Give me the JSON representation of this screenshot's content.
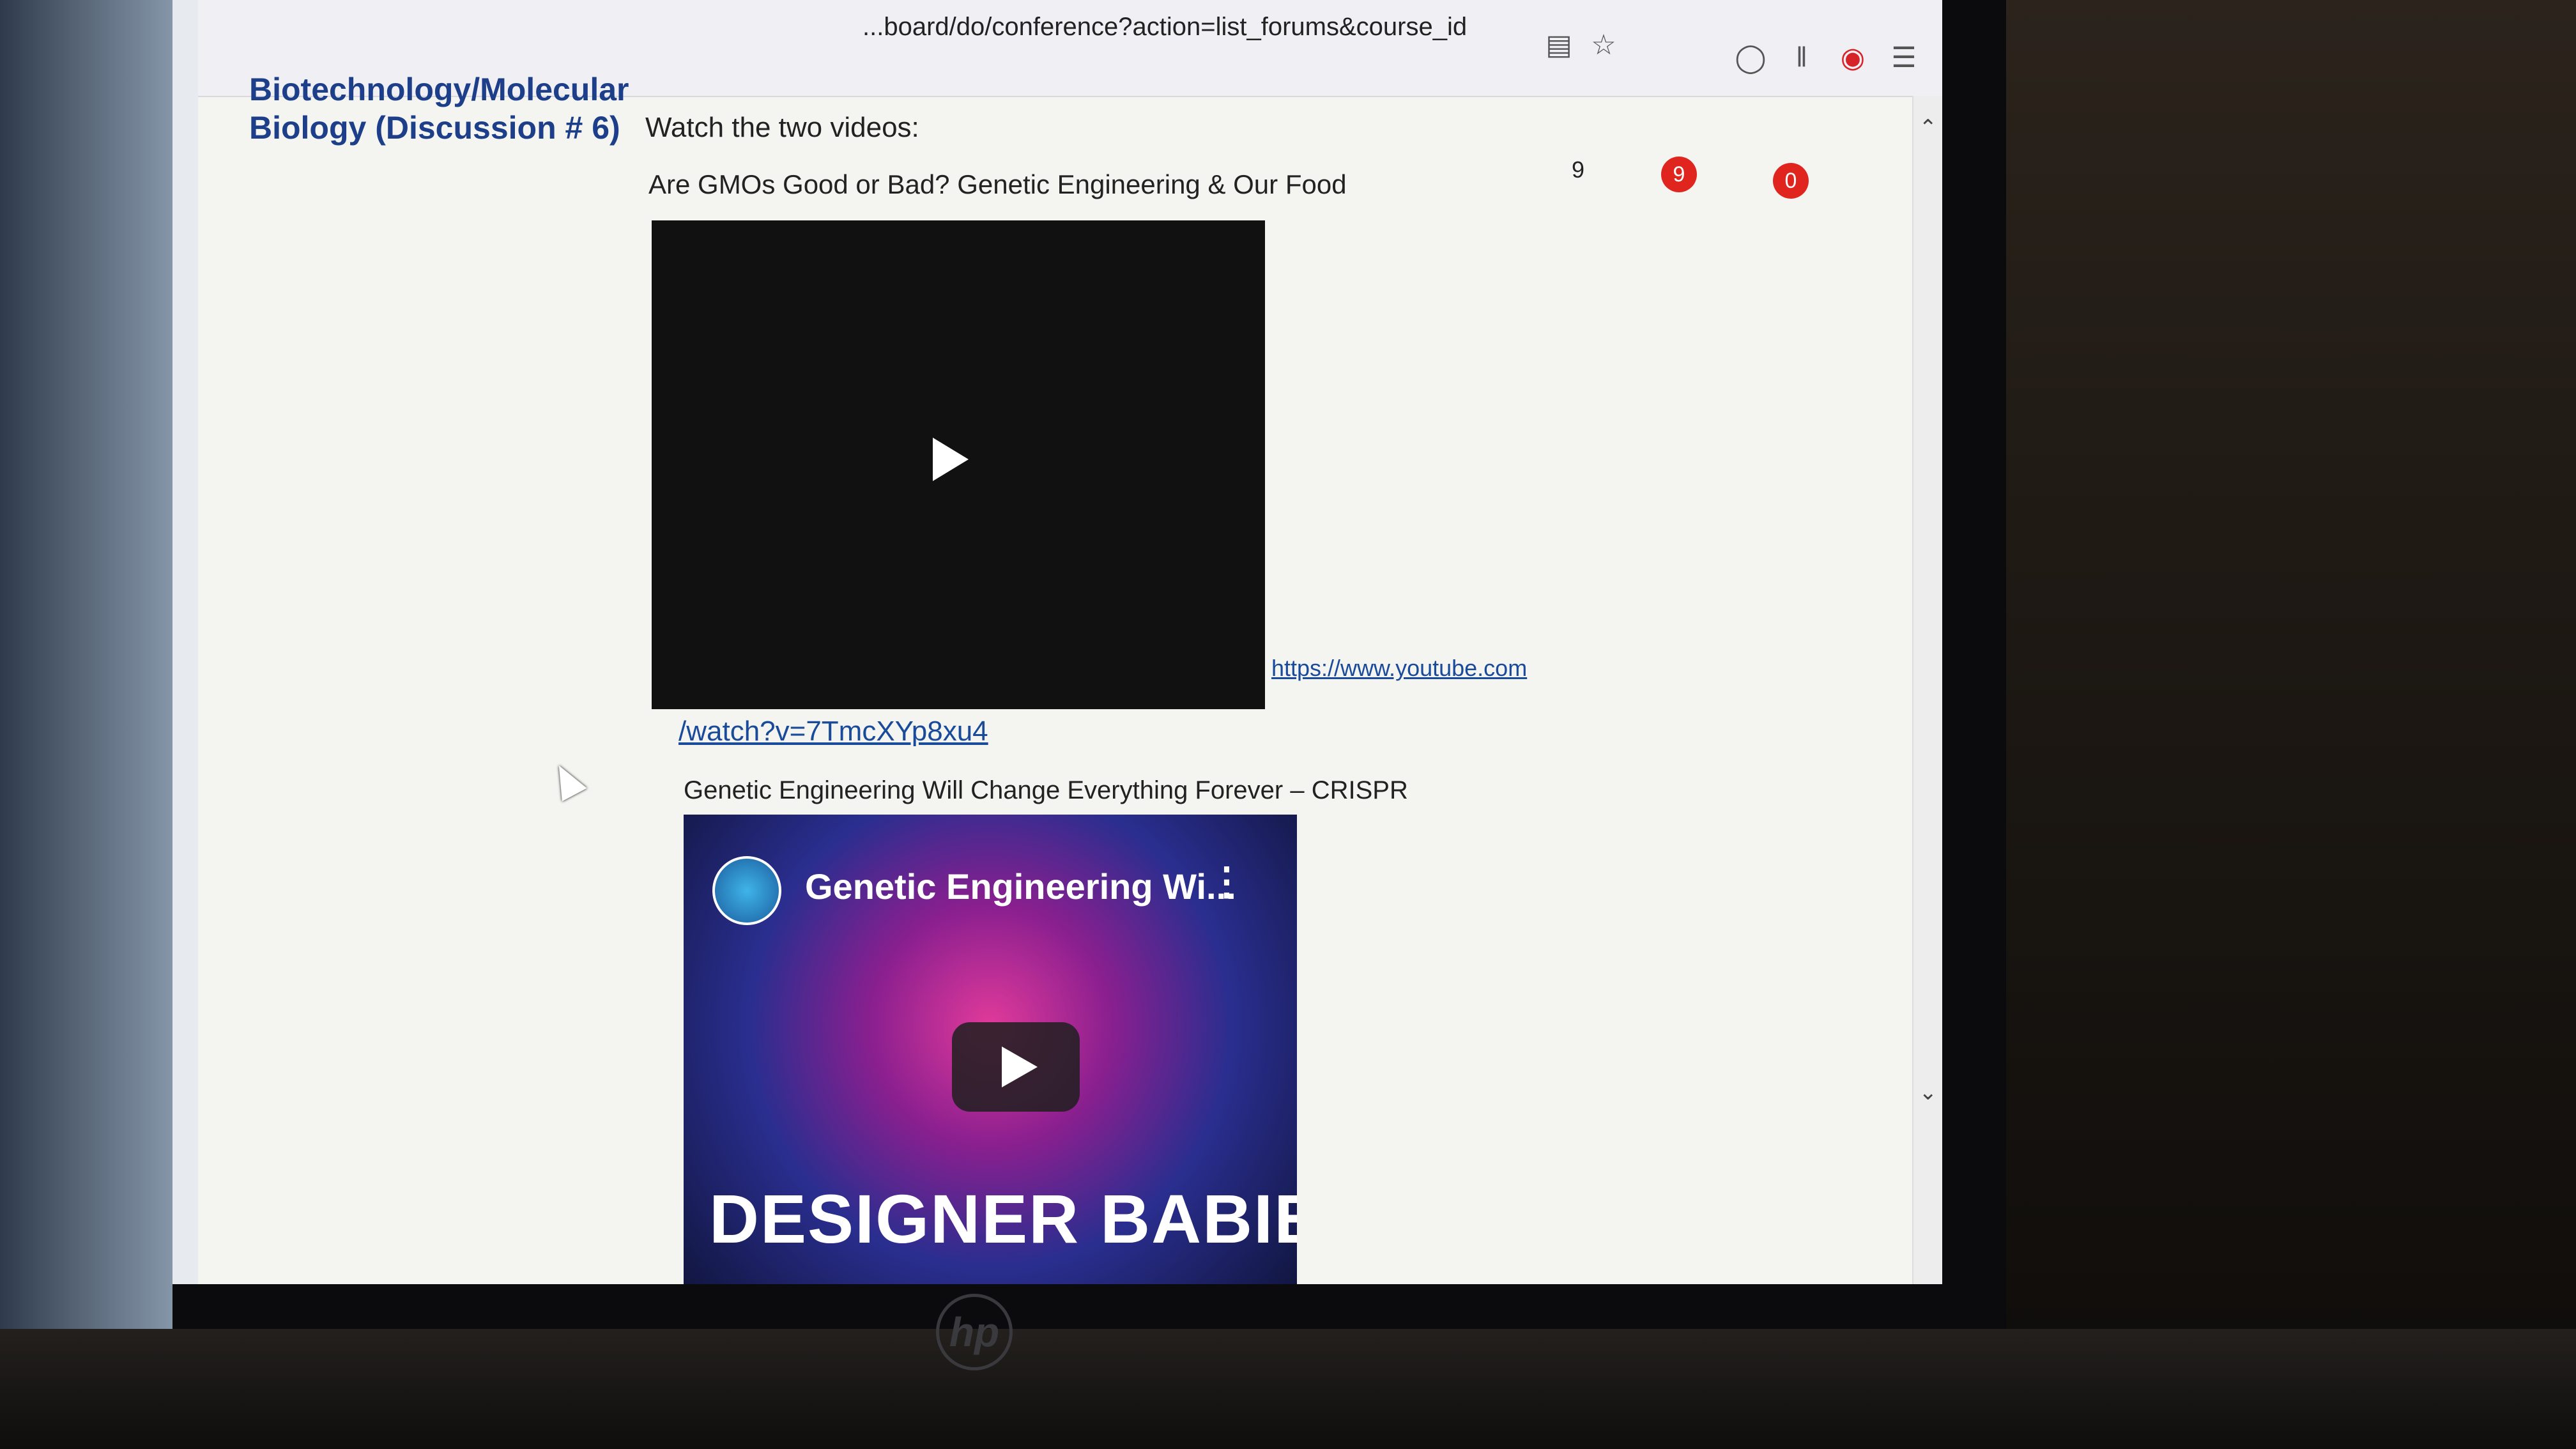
{
  "browser": {
    "url": "...board/do/conference?action=list_forums&course_id",
    "icons": [
      "reader-icon",
      "star-icon",
      "pocket-icon",
      "library-icon",
      "pinterest-icon",
      "menu-icon"
    ]
  },
  "forum": {
    "title": "Biotechnology/Molecular Biology (Discussion # 6)",
    "intro": "Watch the two videos:",
    "video1": {
      "title": "Are GMOs Good or Bad? Genetic Engineering & Our Food",
      "link_part1": "https://www.youtube.com",
      "link_part2": "/watch?v=7TmcXYp8xu4"
    },
    "video2": {
      "title": "Genetic Engineering Will Change Everything Forever – CRISPR",
      "thumb_name": "Genetic Engineering Wi...",
      "thumb_caption": "DESIGNER BABIES",
      "menu": "⋮"
    },
    "counts": {
      "total": "9",
      "unread_badge": "9",
      "reply_badge": "0"
    }
  },
  "device": {
    "brand": "hp"
  }
}
